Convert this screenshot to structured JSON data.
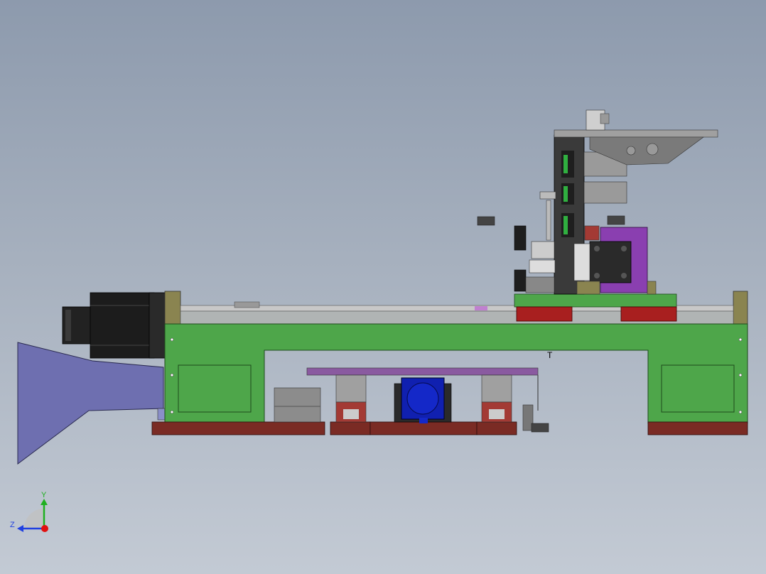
{
  "triad": {
    "y_label": "Y",
    "z_label": "Z",
    "colors": {
      "y": "#1fb020",
      "z": "#2040e0",
      "x": "#e01010"
    }
  },
  "colors": {
    "base_frame": "#4ea64a",
    "feet": "#7a2b24",
    "funnel": "#6e6fb0",
    "motor": "#1c1c1c",
    "purple_plate": "#8a3fb0",
    "red_blocks": "#a81f1f",
    "blue_motor": "#1020b0"
  }
}
